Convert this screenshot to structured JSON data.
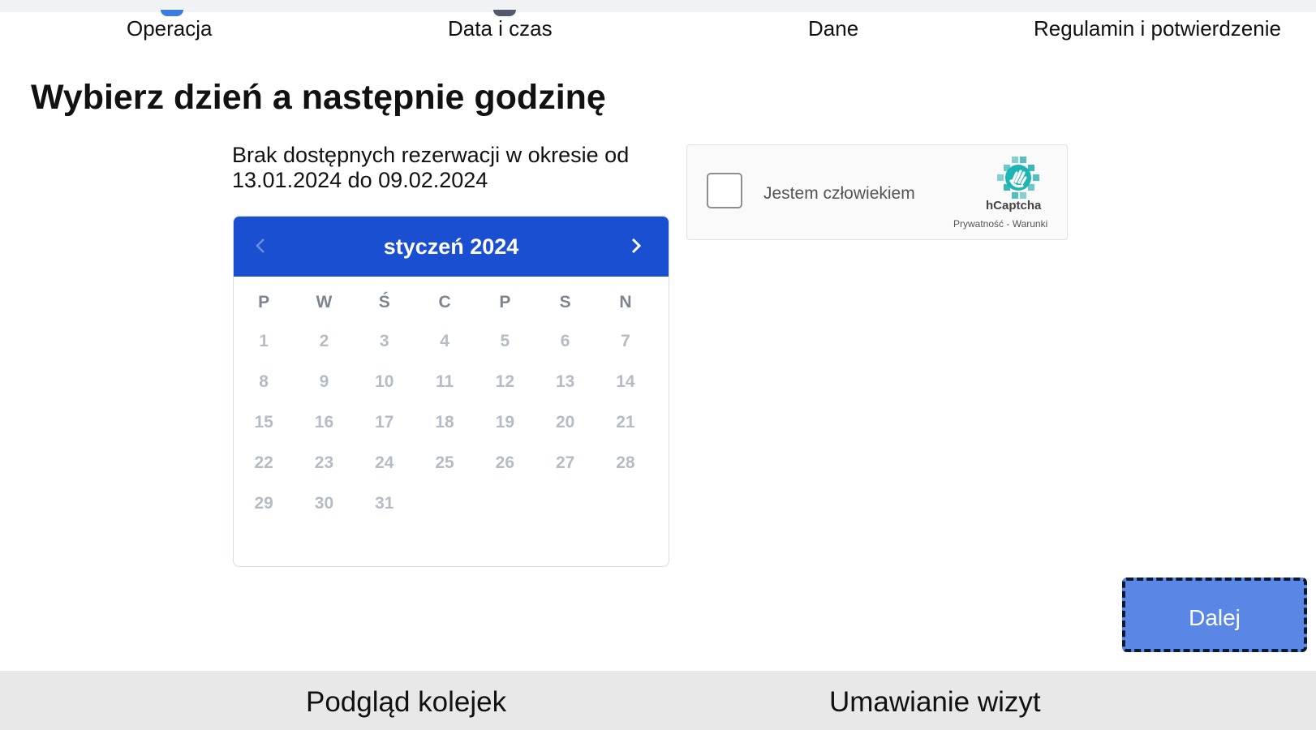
{
  "steps": [
    {
      "label": "Operacja"
    },
    {
      "label": "Data i czas"
    },
    {
      "label": "Dane"
    },
    {
      "label": "Regulamin i potwierdzenie"
    }
  ],
  "heading": "Wybierz dzień a następnie godzinę",
  "no_reservations": "Brak dostępnych rezerwacji w okresie od 13.01.2024 do 09.02.2024",
  "calendar": {
    "month_title": "styczeń 2024",
    "weekdays": [
      "P",
      "W",
      "Ś",
      "C",
      "P",
      "S",
      "N"
    ],
    "weeks": [
      [
        "1",
        "2",
        "3",
        "4",
        "5",
        "6",
        "7"
      ],
      [
        "8",
        "9",
        "10",
        "11",
        "12",
        "13",
        "14"
      ],
      [
        "15",
        "16",
        "17",
        "18",
        "19",
        "20",
        "21"
      ],
      [
        "22",
        "23",
        "24",
        "25",
        "26",
        "27",
        "28"
      ],
      [
        "29",
        "30",
        "31",
        "",
        "",
        "",
        ""
      ]
    ],
    "header_color": "#1a4fd1",
    "disabled_day_color": "#b6bcc5"
  },
  "captcha": {
    "label": "Jestem człowiekiem",
    "brand": "hCaptcha",
    "privacy": "Prywatność",
    "separator": " - ",
    "terms": "Warunki"
  },
  "next_button": "Dalej",
  "bottom_nav": {
    "left": "Podgląd kolejek",
    "right": "Umawianie wizyt"
  },
  "accent_color": "#5a86e6"
}
